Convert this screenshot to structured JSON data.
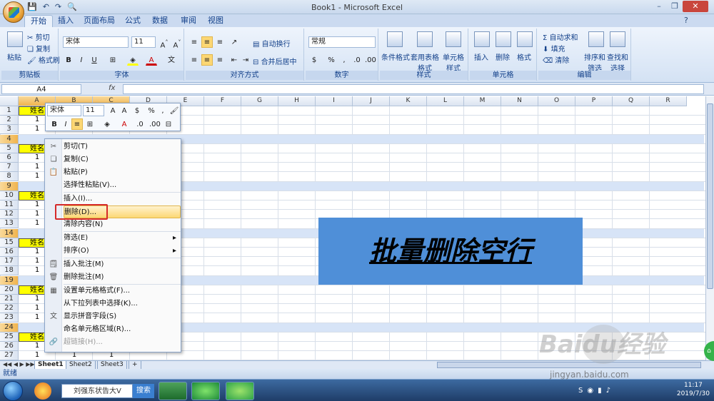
{
  "window": {
    "title": "Book1 - Microsoft Excel"
  },
  "tabs": [
    "开始",
    "插入",
    "页面布局",
    "公式",
    "数据",
    "审阅",
    "视图"
  ],
  "ribbon": {
    "clipboard": {
      "paste": "粘贴",
      "cut": "剪切",
      "copy": "复制",
      "format_painter": "格式刷",
      "label": "剪贴板"
    },
    "font": {
      "name": "宋体",
      "size": "11",
      "label": "字体"
    },
    "alignment": {
      "wrap": "自动换行",
      "merge": "合并后居中",
      "label": "对齐方式"
    },
    "number": {
      "format": "常规",
      "label": "数字"
    },
    "styles": {
      "cond": "条件格式",
      "table": "套用表格格式",
      "cell": "单元格样式",
      "label": "样式"
    },
    "cells": {
      "insert": "插入",
      "delete": "删除",
      "format": "格式",
      "label": "单元格"
    },
    "editing": {
      "autosum": "自动求和",
      "fill": "填充",
      "clear": "清除",
      "sort": "排序和筛选",
      "find": "查找和选择",
      "label": "编辑"
    }
  },
  "formula": {
    "namebox": "A4",
    "fx": "fx"
  },
  "columns": [
    "A",
    "B",
    "C",
    "D",
    "E",
    "F",
    "G",
    "H",
    "I",
    "J",
    "K",
    "L",
    "M",
    "N",
    "O",
    "P",
    "Q",
    "R"
  ],
  "rows": [
    "1",
    "2",
    "3",
    "4",
    "5",
    "6",
    "7",
    "8",
    "9",
    "10",
    "11",
    "12",
    "13",
    "14",
    "15",
    "16",
    "17",
    "18",
    "19",
    "20",
    "21",
    "22",
    "23",
    "24",
    "25",
    "26",
    "27"
  ],
  "cells": {
    "header": "姓名",
    "one": "1"
  },
  "mini_toolbar": {
    "font": "宋体",
    "size": "11",
    "percent": "%",
    "comma": ","
  },
  "context_menu": [
    {
      "label": "剪切(T)",
      "icon": "cut"
    },
    {
      "label": "复制(C)",
      "icon": "copy"
    },
    {
      "label": "粘贴(P)",
      "icon": "paste"
    },
    {
      "label": "选择性粘贴(V)...",
      "icon": ""
    },
    {
      "label": "插入(I)...",
      "icon": ""
    },
    {
      "label": "删除(D)...",
      "icon": ""
    },
    {
      "label": "清除内容(N)",
      "icon": ""
    },
    {
      "label": "筛选(E)",
      "icon": ""
    },
    {
      "label": "排序(O)",
      "icon": ""
    },
    {
      "label": "插入批注(M)",
      "icon": "note"
    },
    {
      "label": "删除批注(M)",
      "icon": "note-del"
    },
    {
      "label": "设置单元格格式(F)...",
      "icon": "format"
    },
    {
      "label": "从下拉列表中选择(K)...",
      "icon": ""
    },
    {
      "label": "显示拼音字段(S)",
      "icon": "pinyin"
    },
    {
      "label": "命名单元格区域(R)...",
      "icon": ""
    },
    {
      "label": "超链接(H)...",
      "icon": "link"
    }
  ],
  "banner": {
    "text": "批量删除空行"
  },
  "sheets": [
    "Sheet1",
    "Sheet2",
    "Sheet3"
  ],
  "status": {
    "text": "就绪"
  },
  "taskbar": {
    "search_value": "刘强东状告大V",
    "search_btn": "搜索",
    "time": "11:17",
    "date": "2019/7/30"
  },
  "watermark": {
    "logo": "Baidu经验",
    "url": "jingyan.baidu.com"
  }
}
